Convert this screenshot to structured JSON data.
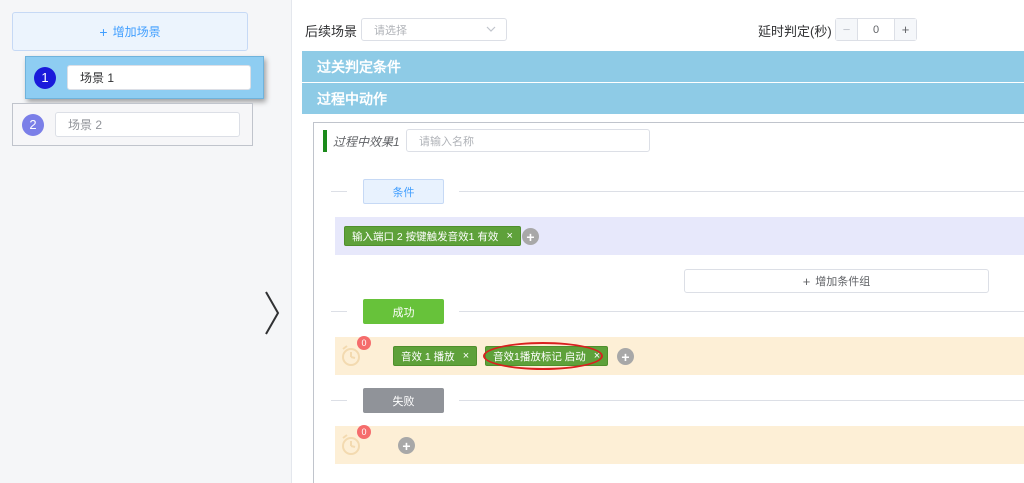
{
  "sidebar": {
    "add_scene_label": "增加场景",
    "scenes": [
      {
        "number": "1",
        "name": "场景 1",
        "active": true
      },
      {
        "number": "2",
        "name": "场景 2",
        "active": false
      }
    ]
  },
  "top_bar": {
    "next_scene_label": "后续场景",
    "next_scene_placeholder": "请选择",
    "delay_label": "延时判定(秒)",
    "delay_value": "0",
    "minus": "−",
    "plus": "+"
  },
  "sections": {
    "pass_conditions": "过关判定条件",
    "process_actions": "过程中动作"
  },
  "effect": {
    "title": "过程中效果1",
    "name_placeholder": "请输入名称",
    "condition_label": "条件",
    "condition_tags": [
      {
        "text": "输入端口 2 按键触发音效1 有效"
      }
    ],
    "add_condition_group": "增加条件组",
    "success_label": "成功",
    "success_badge": "0",
    "success_tags": [
      {
        "text": "音效 1 播放"
      },
      {
        "text": "音效1播放标记 启动"
      }
    ],
    "fail_label": "失败",
    "fail_badge": "0",
    "close_glyph": "×",
    "add_glyph": "+"
  },
  "colors": {
    "accent_blue": "#409eff",
    "section_bar": "#8ecbe6",
    "success_green": "#67c23a",
    "fail_gray": "#909399",
    "highlight_red": "#d9201f"
  }
}
